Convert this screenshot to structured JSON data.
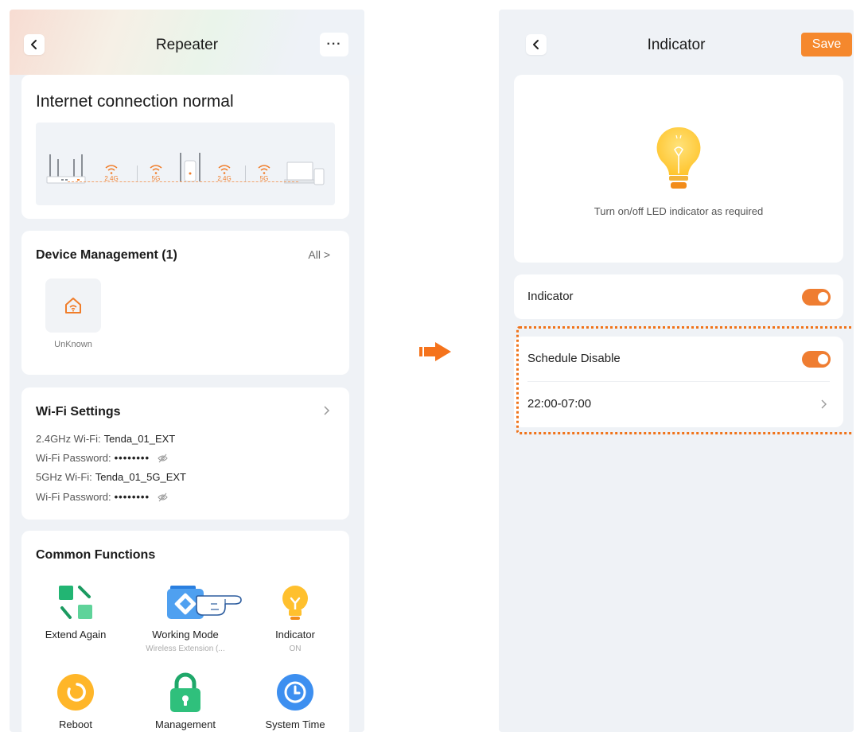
{
  "left_screen": {
    "header": {
      "title": "Repeater",
      "more": "···"
    },
    "status": {
      "text": "Internet connection normal",
      "bands": [
        "2.4G",
        "5G",
        "2.4G",
        "5G"
      ]
    },
    "devices": {
      "title": "Device Management (1)",
      "all_label": "All >",
      "items": [
        {
          "name": "UnKnown",
          "icon": "home-wifi-icon"
        }
      ]
    },
    "wifi": {
      "title": "Wi-Fi Settings",
      "rows": [
        {
          "label": "2.4GHz Wi-Fi:",
          "value": "Tenda_01_EXT"
        },
        {
          "label": "Wi-Fi Password:",
          "value": "••••••••"
        },
        {
          "label": "5GHz Wi-Fi:",
          "value": "Tenda_01_5G_EXT"
        },
        {
          "label": "Wi-Fi Password:",
          "value": "••••••••"
        }
      ]
    },
    "functions": {
      "title": "Common Functions",
      "items": [
        {
          "label": "Extend Again",
          "sub": "",
          "icon": "extend-icon"
        },
        {
          "label": "Working Mode",
          "sub": "Wireless Extension (...",
          "icon": "working-mode-icon"
        },
        {
          "label": "Indicator",
          "sub": "ON",
          "icon": "bulb-icon"
        },
        {
          "label": "Reboot",
          "sub": "",
          "icon": "reboot-icon"
        },
        {
          "label": "Management",
          "sub": "",
          "icon": "lock-icon"
        },
        {
          "label": "System Time",
          "sub": "",
          "icon": "clock-icon"
        }
      ]
    }
  },
  "right_screen": {
    "header": {
      "title": "Indicator",
      "save_label": "Save"
    },
    "hero": {
      "text": "Turn on/off LED indicator as required"
    },
    "indicator": {
      "label": "Indicator",
      "enabled": true
    },
    "schedule": {
      "label": "Schedule Disable",
      "enabled": true,
      "time": "22:00-07:00"
    }
  },
  "colors": {
    "accent": "#f5882d",
    "highlight_frame": "#f07319",
    "background": "#eff2f6"
  }
}
